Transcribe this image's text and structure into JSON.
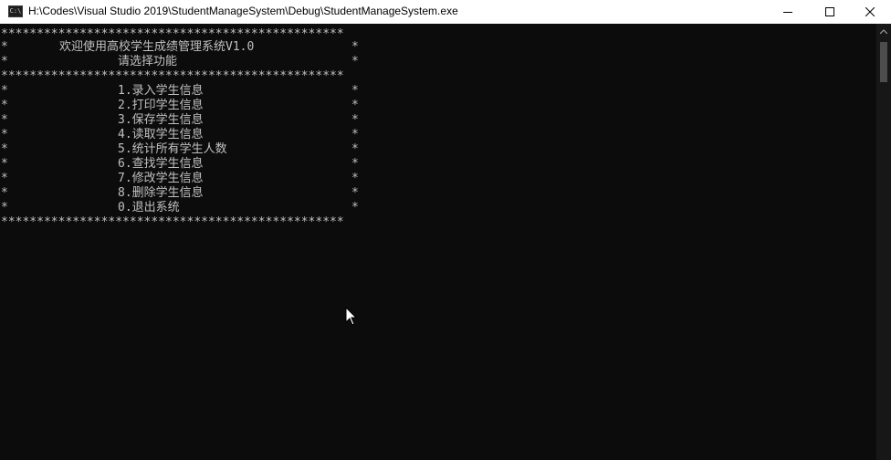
{
  "window": {
    "title": "H:\\Codes\\Visual Studio 2019\\StudentManageSystem\\Debug\\StudentManageSystem.exe",
    "icon": "console-app-icon",
    "icon_label": "C:\\"
  },
  "controls": {
    "minimize_icon": "minimize-icon",
    "maximize_icon": "maximize-icon",
    "close_icon": "close-icon"
  },
  "console": {
    "border": "************************************************",
    "edge": "*",
    "welcome": "欢迎使用高校学生成绩管理系统V1.0",
    "prompt": "请选择功能",
    "menu": [
      "1.录入学生信息",
      "2.打印学生信息",
      "3.保存学生信息",
      "4.读取学生信息",
      "5.统计所有学生人数",
      "6.查找学生信息",
      "7.修改学生信息",
      "8.删除学生信息",
      "0.退出系统"
    ]
  },
  "colors": {
    "console_bg": "#0c0c0c",
    "console_text": "#c0c0c0",
    "titlebar_bg": "#ffffff"
  }
}
